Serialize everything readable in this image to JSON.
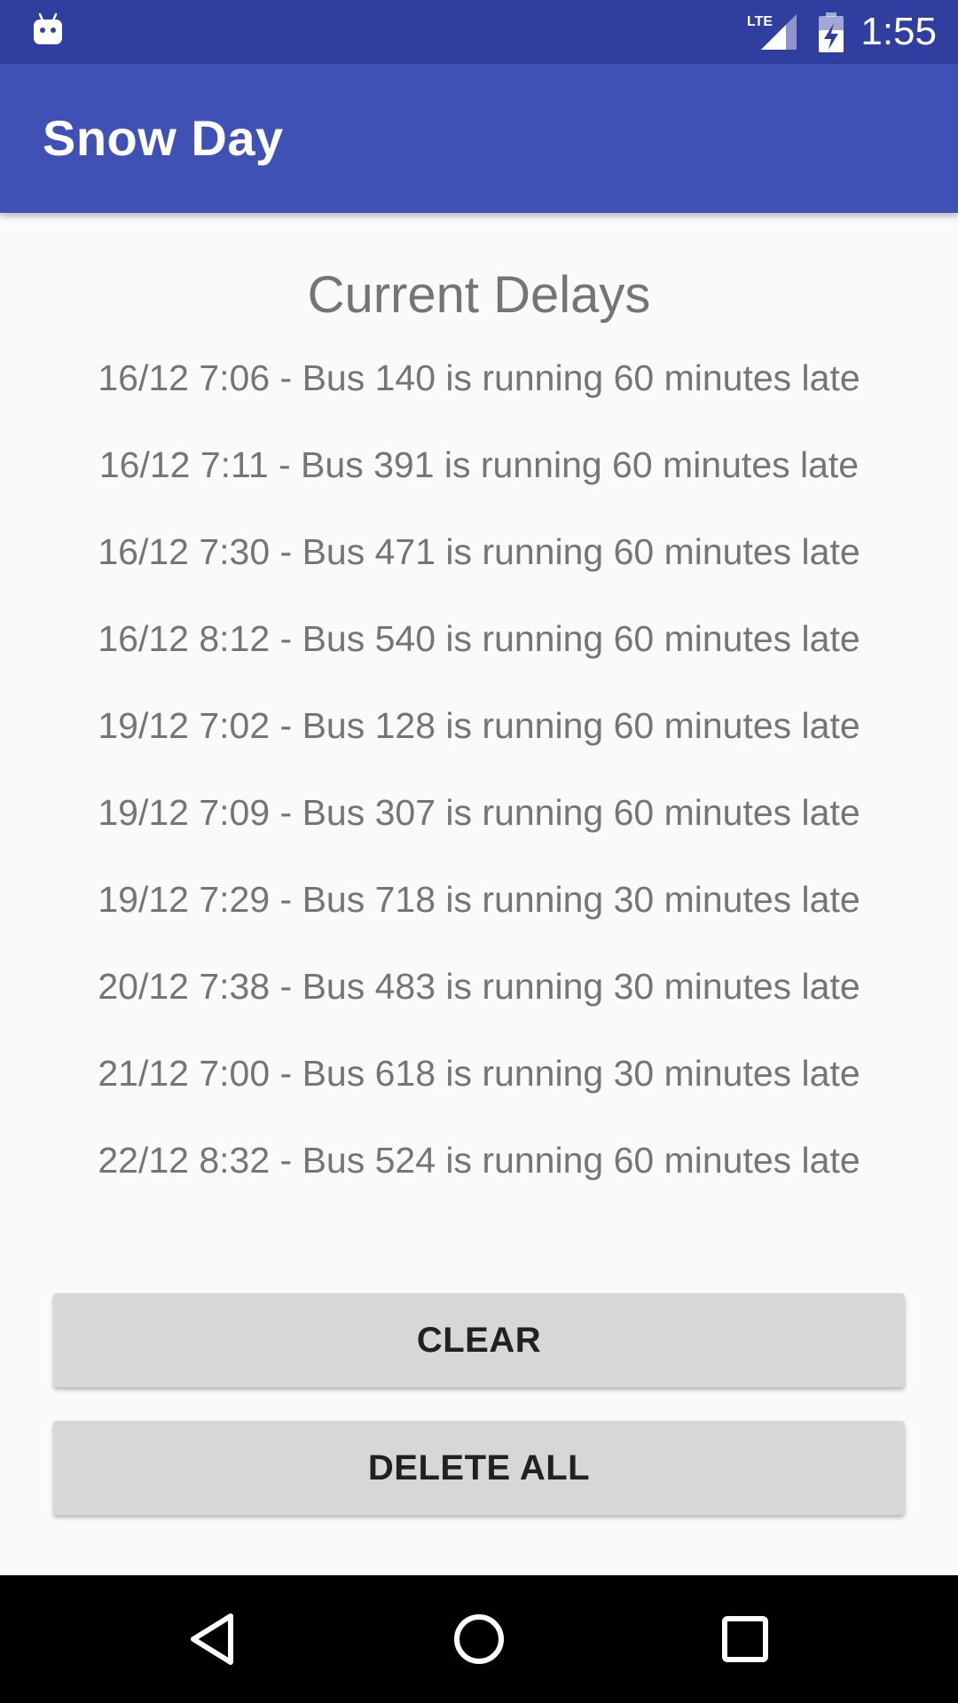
{
  "status_bar": {
    "time": "1:55",
    "network_label": "LTE",
    "icons": [
      "android-debug-icon",
      "lte-signal-icon",
      "battery-charging-icon"
    ]
  },
  "app_bar": {
    "title": "Snow Day"
  },
  "main": {
    "heading": "Current Delays",
    "delays": [
      "16/12 7:06 - Bus 140 is running 60 minutes late",
      "16/12 7:11 - Bus 391 is running 60 minutes late",
      "16/12 7:30 - Bus 471 is running 60 minutes late",
      "16/12 8:12 - Bus 540 is running 60 minutes late",
      "19/12 7:02 - Bus 128 is running 60 minutes late",
      "19/12 7:09 - Bus 307 is running 60 minutes late",
      "19/12 7:29 - Bus 718 is running 30 minutes late",
      "20/12 7:38 - Bus 483 is running 30 minutes late",
      "21/12 7:00 - Bus 618 is running 30 minutes late",
      "22/12 8:32 - Bus 524 is running 60 minutes late"
    ],
    "buttons": {
      "clear_label": "CLEAR",
      "delete_all_label": "DELETE ALL"
    }
  },
  "nav_bar": {
    "icons": [
      "back-icon",
      "home-icon",
      "recents-icon"
    ]
  },
  "colors": {
    "status_bar": "#303f9f",
    "app_bar": "#3f51b5",
    "background": "#fafafa",
    "text_secondary": "#757575",
    "button_bg": "#d6d7d7",
    "button_text": "#212121"
  }
}
